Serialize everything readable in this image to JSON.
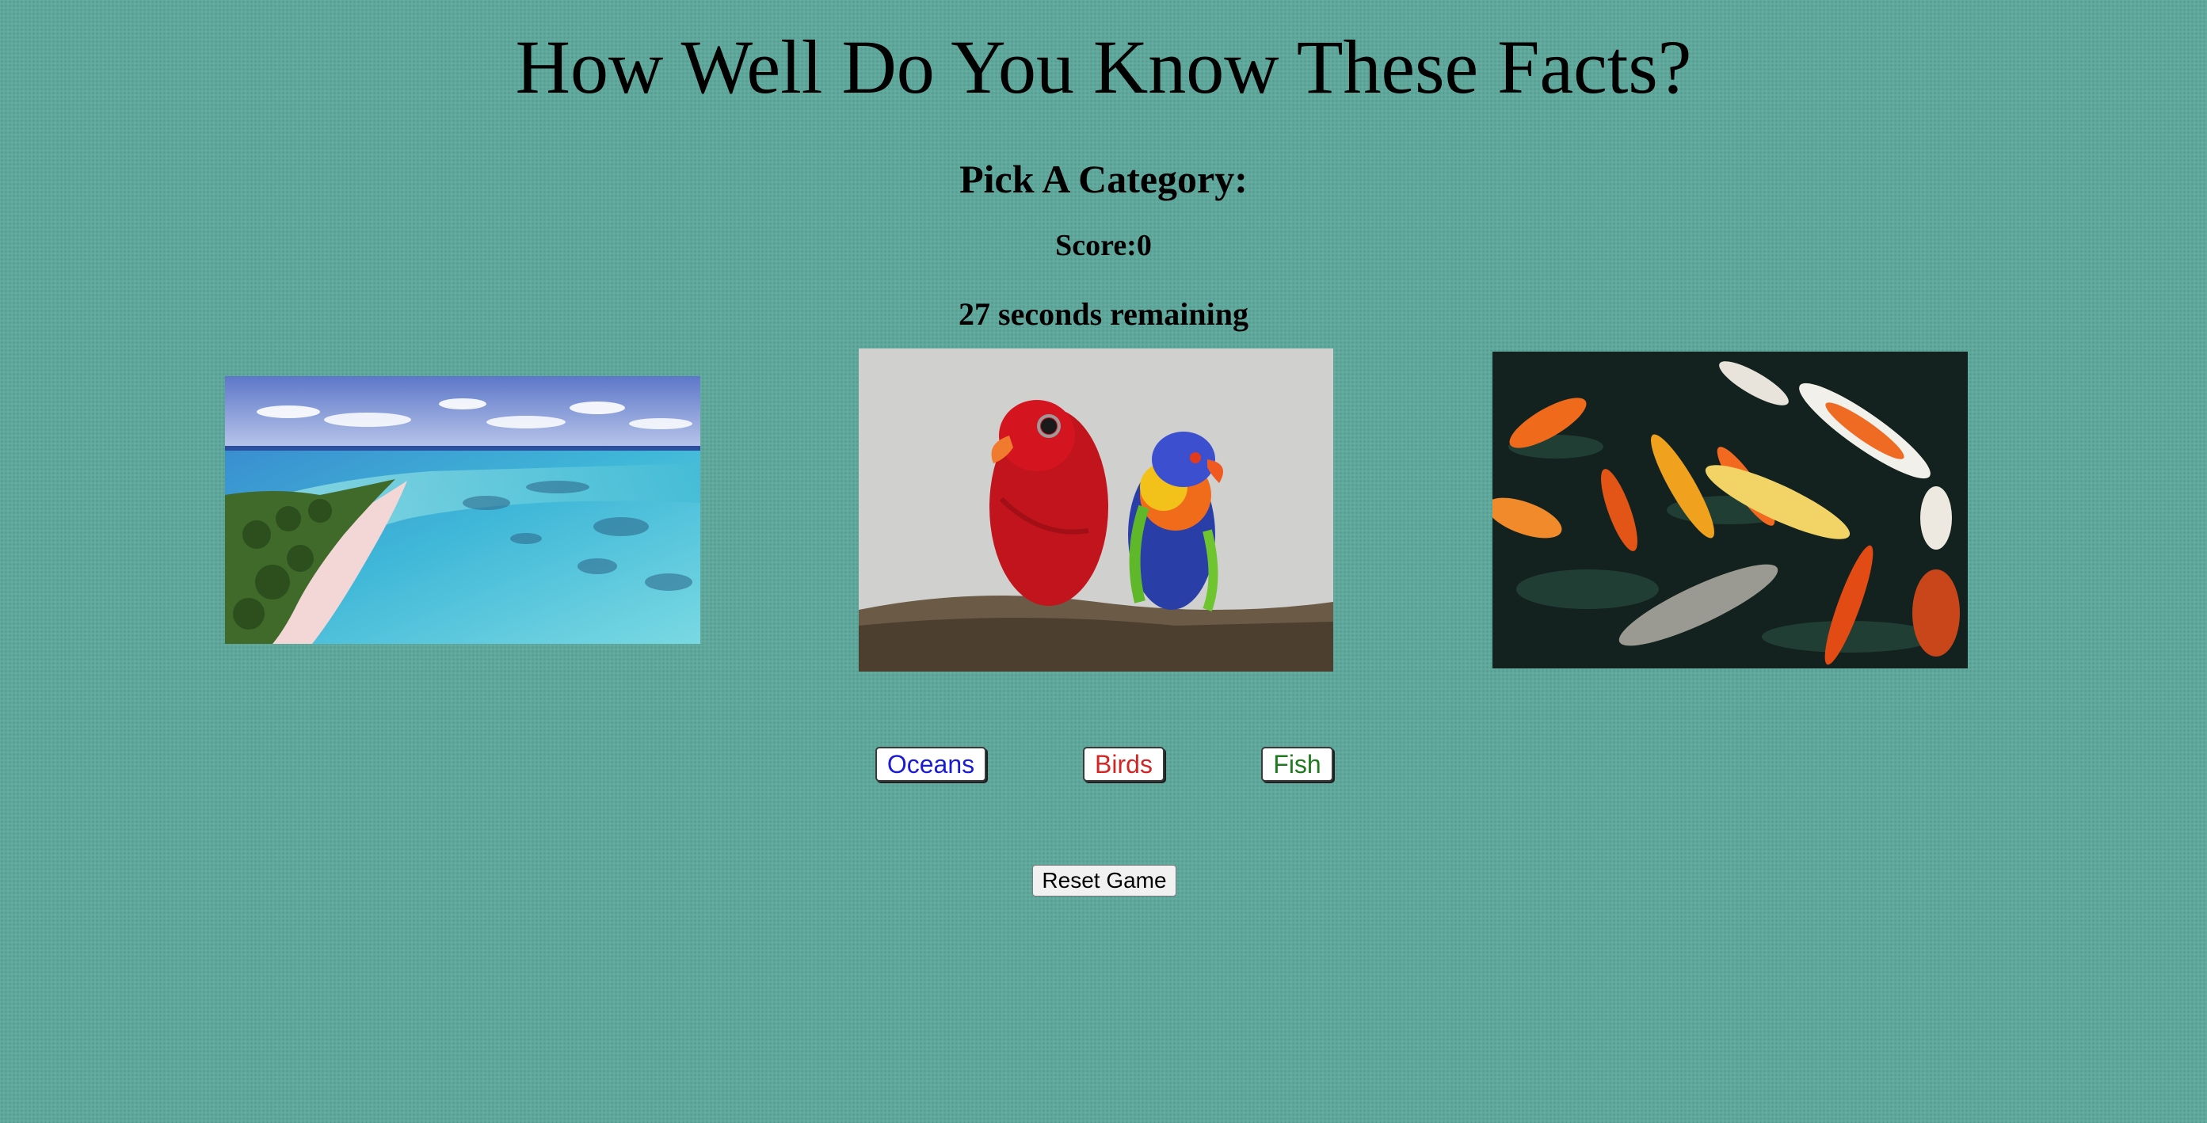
{
  "page": {
    "title": "How Well Do You Know These Facts?",
    "subtitle": "Pick A Category:",
    "score_text": "Score:0",
    "timer_text": "27 seconds remaining"
  },
  "images": [
    {
      "name": "ocean-beach-image",
      "subject": "aerial view of tropical beach and turquoise ocean"
    },
    {
      "name": "parrots-image",
      "subject": "red parrot and rainbow lorikeet on a branch"
    },
    {
      "name": "koi-fish-image",
      "subject": "koi fish swimming in a dark pond"
    }
  ],
  "categories": {
    "oceans": {
      "label": "Oceans",
      "color": "#1b1bd6"
    },
    "birds": {
      "label": "Birds",
      "color": "#d42525"
    },
    "fish": {
      "label": "Fish",
      "color": "#1f7a1f"
    }
  },
  "reset": {
    "label": "Reset Game"
  },
  "colors": {
    "background": "#5fa89c"
  }
}
